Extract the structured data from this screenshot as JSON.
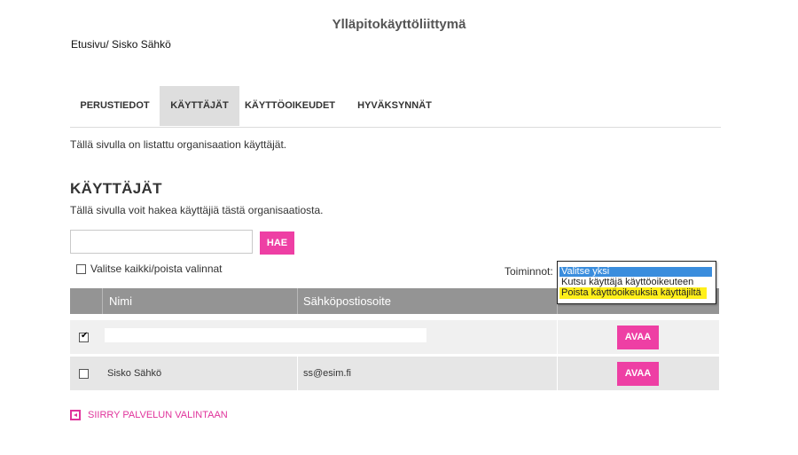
{
  "app": {
    "title": "Ylläpitokäyttöliittymä"
  },
  "breadcrumb": {
    "home": "Etusivu",
    "separator": "/",
    "current": "Sisko Sähkö"
  },
  "tabs": [
    {
      "label": "PERUSTIEDOT",
      "active": false
    },
    {
      "label": "KÄYTTÄJÄT",
      "active": true
    },
    {
      "label": "KÄYTTÖOIKEUDET",
      "active": false
    },
    {
      "label": "HYVÄKSYNNÄT",
      "active": false
    }
  ],
  "intro": "Tällä sivulla on listattu organisaation käyttäjät.",
  "section": {
    "title": "KÄYTTÄJÄT",
    "description": "Tällä sivulla voit hakea käyttäjiä tästä organisaatiosta."
  },
  "search": {
    "value": "",
    "placeholder": "",
    "button_label": "HAE"
  },
  "select_all": {
    "label": "Valitse kaikki/poista valinnat",
    "checked": false
  },
  "actions": {
    "label": "Toiminnot:",
    "options": [
      "Valitse yksi",
      "Kutsu käyttäjä käyttöoikeuteen",
      "Poista käyttöoikeuksia käyttäjiltä"
    ],
    "selected": "Valitse yksi"
  },
  "table": {
    "columns": [
      "",
      "Nimi",
      "Sähköpostiosoite",
      ""
    ],
    "rows": [
      {
        "checked": true,
        "name": "",
        "email": "",
        "action": "AVAA"
      },
      {
        "checked": false,
        "name": "Sisko Sähkö",
        "email": "ss@esim.fi",
        "action": "AVAA"
      }
    ]
  },
  "back_link": {
    "label": "SIIRRY PALVELUN VALINTAAN"
  },
  "colors": {
    "accent": "#ee3fa4",
    "header": "#949494",
    "tab_active": "#dedede",
    "highlight": "#ffef1a",
    "selection": "#3a8ddd"
  }
}
